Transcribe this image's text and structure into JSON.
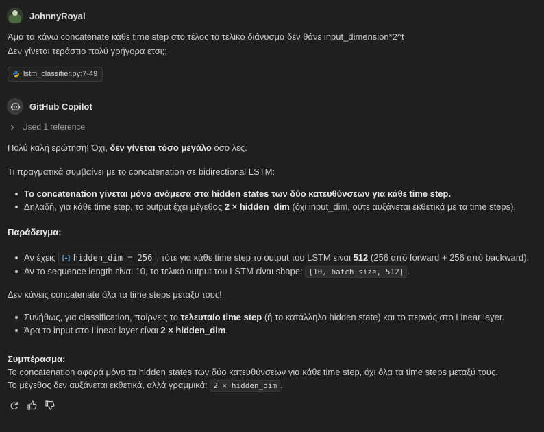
{
  "user": {
    "name": "JohnnyRoyal",
    "message_line1": "Άμα τα κάνω concatenate κάθε time step στο τέλος το τελικό διάνυσμα δεν θάνε input_dimension*2^t",
    "message_line2": "Δεν γίνεται τεράστιο πολύ γρήγορα ετσι;;",
    "file_ref": "lstm_classifier.py:7-49"
  },
  "assistant": {
    "name": "GitHub Copilot",
    "used_reference": "Used 1 reference",
    "p1_pre": "Πολύ καλή ερώτηση! Όχι, ",
    "p1_bold": "δεν γίνεται τόσο μεγάλο",
    "p1_post": " όσο λες.",
    "p2": "Τι πραγματικά συμβαίνει με το concatenation σε bidirectional LSTM:",
    "b1_bold": "Το concatenation γίνεται μόνο ανάμεσα στα hidden states των δύο κατευθύνσεων για κάθε time step.",
    "b2_pre": "Δηλαδή, για κάθε time step, το output έχει μέγεθος ",
    "b2_bold": "2 × hidden_dim",
    "b2_post": " (όχι input_dim, ούτε αυξάνεται εκθετικά με τα time steps).",
    "example_heading": "Παράδειγμα:",
    "b3_pre": "Αν έχεις ",
    "b3_chip": "hidden_dim = 256",
    "b3_mid": ", τότε για κάθε time step το output του LSTM είναι ",
    "b3_bold": "512",
    "b3_post": " (256 από forward + 256 από backward).",
    "b4_pre": "Αν το sequence length είναι 10, το τελικό output του LSTM είναι shape: ",
    "b4_code": "[10, batch_size, 512]",
    "b4_post": ".",
    "p3": "Δεν κάνεις concatenate όλα τα time steps μεταξύ τους!",
    "b5_pre": "Συνήθως, για classification, παίρνεις το ",
    "b5_bold": "τελευταίο time step",
    "b5_post": " (ή το κατάλληλο hidden state) και το περνάς στο Linear layer.",
    "b6_pre": "Άρα το input στο Linear layer είναι ",
    "b6_bold": "2 × hidden_dim",
    "b6_post": ".",
    "conclusion_heading": "Συμπέρασμα:",
    "c1": "Το concatenation αφορά μόνο τα hidden states των δύο κατευθύνσεων για κάθε time step, όχι όλα τα time steps μεταξύ τους.",
    "c2_pre": "Το μέγεθος δεν αυξάνεται εκθετικά, αλλά γραμμικά: ",
    "c2_code": "2 × hidden_dim",
    "c2_post": "."
  },
  "icons": {
    "python_file": "python-icon",
    "chevron": "chevron-right-icon",
    "symbol": "symbol-variable-icon",
    "retry": "retry-icon",
    "thumbs_up": "thumbs-up-icon",
    "thumbs_down": "thumbs-down-icon"
  },
  "colors": {
    "background": "#1f1f1f",
    "text": "#cccccc",
    "bold_text": "#e6e6e6",
    "muted": "#9d9d9d",
    "symbol_accent": "#75beff"
  }
}
